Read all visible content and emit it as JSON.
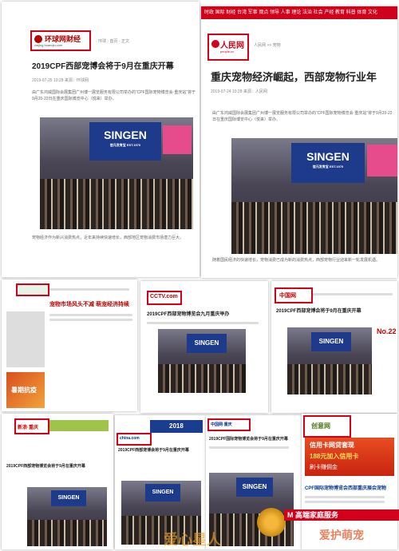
{
  "cards": {
    "huanqiu": {
      "logo": "环球网财经",
      "logo_sub": "caijing.huanqiu.com",
      "breadcrumb": "· 环球 · 首页 · 正文",
      "title": "2019CPF西部宠博会将于9月在重庆开幕",
      "meta": "2019-07-25 10:28 来源：环球网",
      "para1": "由广东鸿威国际会展集团广州博一展览服务有限公司举办的“CPF国际宠物博览会·重庆站”将于9月20-22日在重庆国际博览中心（悦来）举办。",
      "booth": "SINGEN",
      "booth_sub": "信元发育宝 EST.1970",
      "para2": "宠物经济作为新兴消费热点，近年来持续快速增长，西部地区宠物消费市场潜力巨大。"
    },
    "people": {
      "nav": "时政 国际 财经 台湾 军事 观点 领导 人事 理论 法治 社会 产经 教育 科普 体育 文化",
      "logo": "人民网",
      "logo_sub": "people.cn",
      "breadcrumb": "人民网 >> 宠物",
      "title": "重庆宠物经济崛起，西部宠物行业年",
      "meta": "2019-07-24 10:28 来源：人民网",
      "para1": "由广东鸿威国际会展集团广州博一展览服务有限公司举办的“CPF国际宠物博览会·重庆站”将于9月20-22日在重庆国际博览中心（悦来）举办。",
      "booth": "SINGEN",
      "booth_sub": "信元发育宝 EST.1970",
      "para2": "随着国民经济的快速增长，宠物消费已成为新的消费热点，西部宠物行业迎来新一轮发展机遇。"
    },
    "xinhua": {
      "title": "宠物市场风头不减 萌宠经济持续",
      "ad": "暑期抗疫"
    },
    "cctv": {
      "logo": "CCTV.com",
      "title": "2019CPF西部宠物博览会九月重庆举办",
      "booth": "SINGEN"
    },
    "china": {
      "logo": "中国网",
      "title": "2019CPF西部宠博会将于9月在重庆开幕",
      "booth": "SINGEN",
      "side_number": "No.22"
    },
    "sina": {
      "logo": "新浪·重庆",
      "title": "2019CPF西部宠物博览会将于9月在重庆开幕",
      "booth": "SINGEN"
    },
    "chinacom": {
      "logo": "china.com",
      "badge": "2018",
      "title": "2019CPF西部宠博会将于9月在重庆开幕",
      "booth": "SINGEN"
    },
    "sohu": {
      "logo": "中国网·重庆",
      "title": "2019CPF国际宠物博览会将于9月在重庆开幕",
      "booth": "SINGEN"
    },
    "weibo": {
      "logo": "创意网",
      "ad_title": "信用卡网贷套现",
      "ad_line": "188元加入信用卡",
      "ad_line2": "刷卡赚佣金",
      "title": "CPF国际宠物博览会西部重庆展会宠物"
    }
  },
  "watermark": {
    "left": "爱心星人",
    "right": "爱护萌宠"
  },
  "ribbon": {
    "text": "M 高端家庭服务"
  }
}
